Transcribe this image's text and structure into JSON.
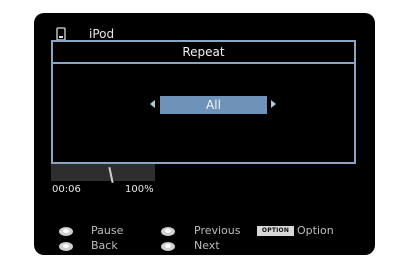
{
  "source": {
    "title": "iPod",
    "icon": "ipod-icon"
  },
  "dialog": {
    "title": "Repeat",
    "value": "All",
    "left_arrow_icon": "left-arrow-icon",
    "right_arrow_icon": "right-arrow-icon"
  },
  "status": {
    "time": "00:06",
    "volume": "100%"
  },
  "legend": {
    "pause": "Pause",
    "back": "Back",
    "previous": "Previous",
    "next": "Next",
    "option_key": "OPTION",
    "option": "Option"
  },
  "colors": {
    "accent": "#8aa6c4",
    "highlight": "#6f93b8",
    "background": "#000000"
  }
}
